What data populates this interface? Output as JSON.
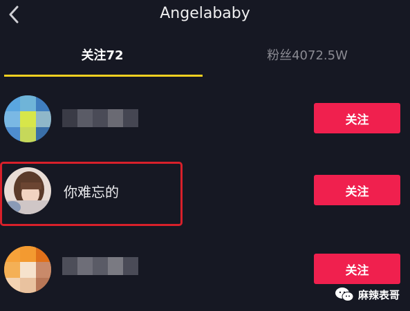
{
  "header": {
    "title": "Angelababy",
    "back_icon": "chevron-left-icon"
  },
  "tabs": [
    {
      "label": "关注72",
      "active": true
    },
    {
      "label": "粉丝4072.5W",
      "active": false
    }
  ],
  "colors": {
    "background": "#161823",
    "accent_tab": "#f5d020",
    "follow_button": "#f0204e",
    "highlight_box": "#d8202a"
  },
  "users": [
    {
      "name": "",
      "name_pixelated": true,
      "follow_label": "关注"
    },
    {
      "name": "你难忘的",
      "name_pixelated": false,
      "follow_label": "关注",
      "highlighted": true
    },
    {
      "name": "",
      "name_pixelated": true,
      "follow_label": "关注"
    }
  ],
  "watermark": {
    "text": "麻辣表哥",
    "icon": "wechat-icon"
  }
}
